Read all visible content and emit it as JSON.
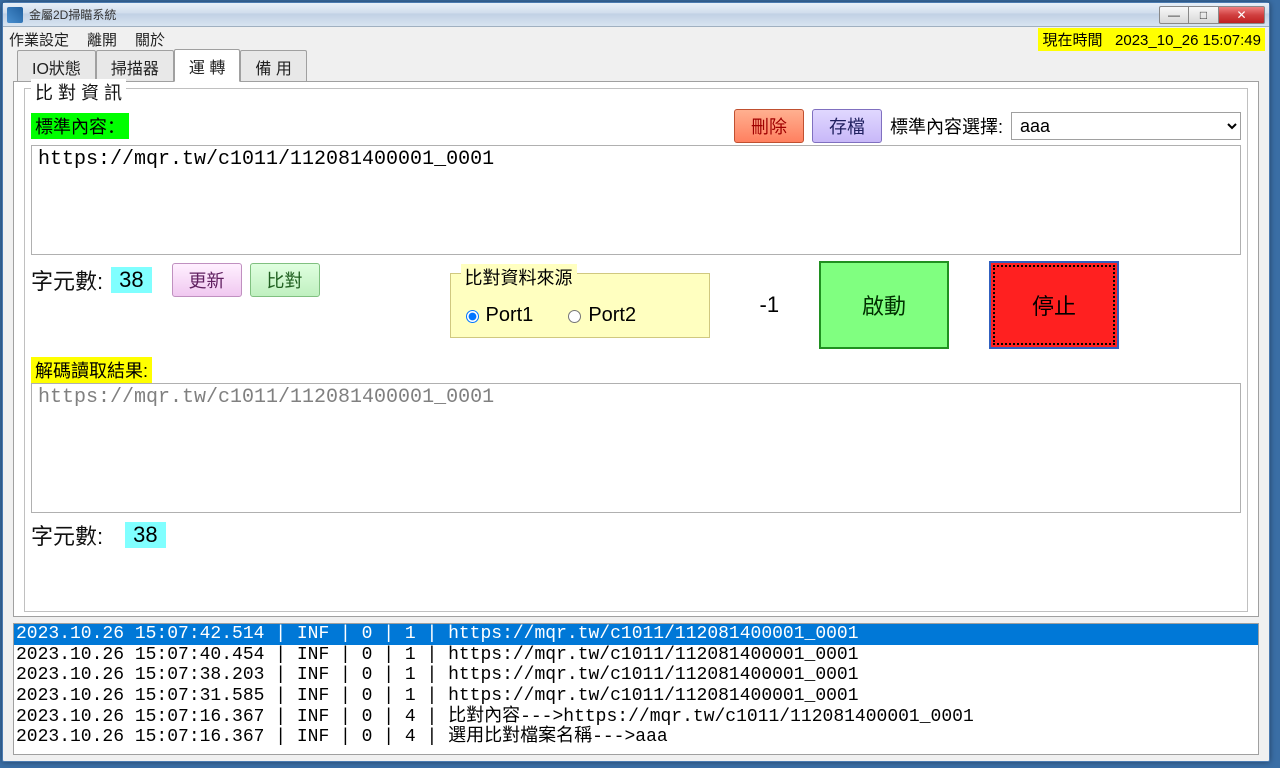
{
  "window": {
    "title": "金屬2D掃瞄系統"
  },
  "menu": {
    "m1": "作業設定",
    "m2": "離開",
    "m3": "關於"
  },
  "time": {
    "label": "現在時間",
    "value": "2023_10_26 15:07:49"
  },
  "tabs": {
    "t1": "IO狀態",
    "t2": "掃描器",
    "t3": "運 轉",
    "t4": "備 用"
  },
  "compare": {
    "legend": "比 對 資 訊",
    "std_label": "標準內容：",
    "delete": "刪除",
    "save": "存檔",
    "select_label": "標準內容選擇:",
    "select_value": "aaa",
    "std_text": "https://mqr.tw/c1011/112081400001_0001",
    "count_label1": "字元數:",
    "count_val1": "38",
    "update": "更新",
    "compare_btn": "比對",
    "port_legend": "比對資料來源",
    "port1": "Port1",
    "port2": "Port2",
    "neg1": "-1",
    "start": "啟動",
    "stop": "停止",
    "decode_label": "解碼讀取結果:",
    "decode_text": "https://mqr.tw/c1011/112081400001_0001",
    "count_label2": "字元數:",
    "count_val2": "38"
  },
  "log": [
    "2023.10.26 15:07:42.514 | INF | 0 | 1 | https://mqr.tw/c1011/112081400001_0001",
    "2023.10.26 15:07:40.454 | INF | 0 | 1 | https://mqr.tw/c1011/112081400001_0001",
    "2023.10.26 15:07:38.203 | INF | 0 | 1 | https://mqr.tw/c1011/112081400001_0001",
    "2023.10.26 15:07:31.585 | INF | 0 | 1 | https://mqr.tw/c1011/112081400001_0001",
    "2023.10.26 15:07:16.367 | INF | 0 | 4 | 比對內容--->https://mqr.tw/c1011/112081400001_0001",
    "2023.10.26 15:07:16.367 | INF | 0 | 4 | 選用比對檔案名稱--->aaa"
  ]
}
